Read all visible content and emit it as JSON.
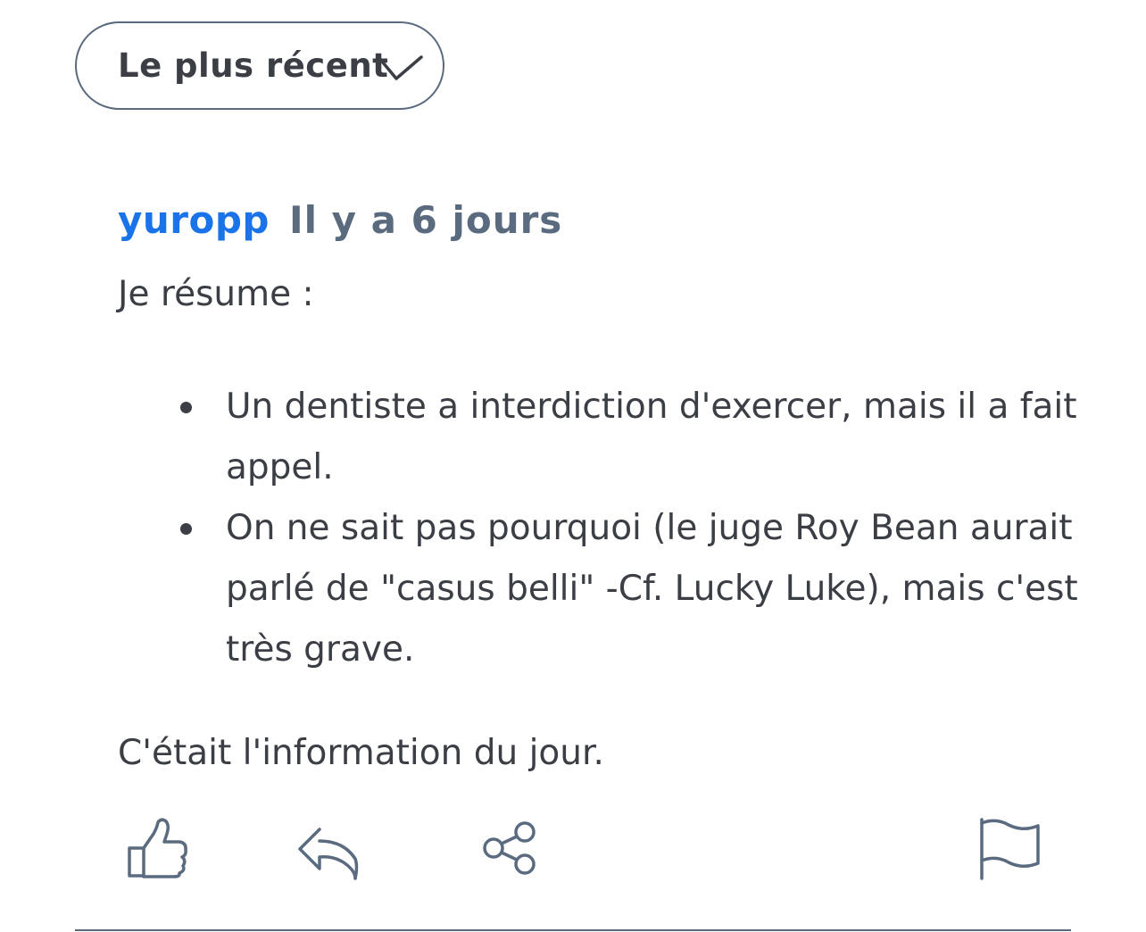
{
  "sort": {
    "label": "Le plus récent",
    "icon": "chevron-down-icon"
  },
  "comment": {
    "author": "yuropp",
    "time": "Il y a 6 jours",
    "intro": "Je résume :",
    "bullets": [
      "Un dentiste a interdiction d'exercer, mais il a fait appel.",
      "On ne sait pas pourquoi (le juge Roy Bean aurait parlé de \"casus belli\" -Cf. Lucky Luke), mais c'est très grave."
    ],
    "outro": "C'était l'information du jour."
  },
  "actions": {
    "like_icon": "thumbs-up-icon",
    "reply_icon": "reply-icon",
    "share_icon": "share-icon",
    "report_icon": "flag-icon"
  },
  "colors": {
    "author": "#1a73e8",
    "meta": "#5b6b7f",
    "text": "#3b3f45",
    "icon": "#5a6b80"
  }
}
